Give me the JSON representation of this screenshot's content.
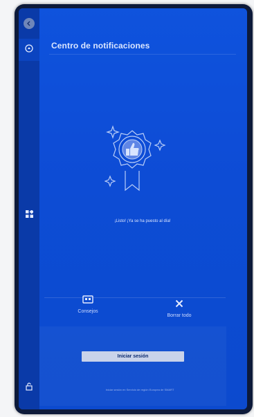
{
  "panel": {
    "title": "Centro de notificaciones",
    "empty_message": "¡Listo! ¡Ya se ha puesto al día!"
  },
  "actions": {
    "tips_label": "Consejos",
    "clear_all_label": "Borrar todo"
  },
  "signin": {
    "button_label": "Iniciar sesión",
    "footer": "Iniciar sesión en Servicio de región Europea de SMART"
  },
  "sidebar": {
    "icons": [
      "back-icon",
      "notification-icon",
      "apps-icon",
      "lock-icon"
    ]
  }
}
